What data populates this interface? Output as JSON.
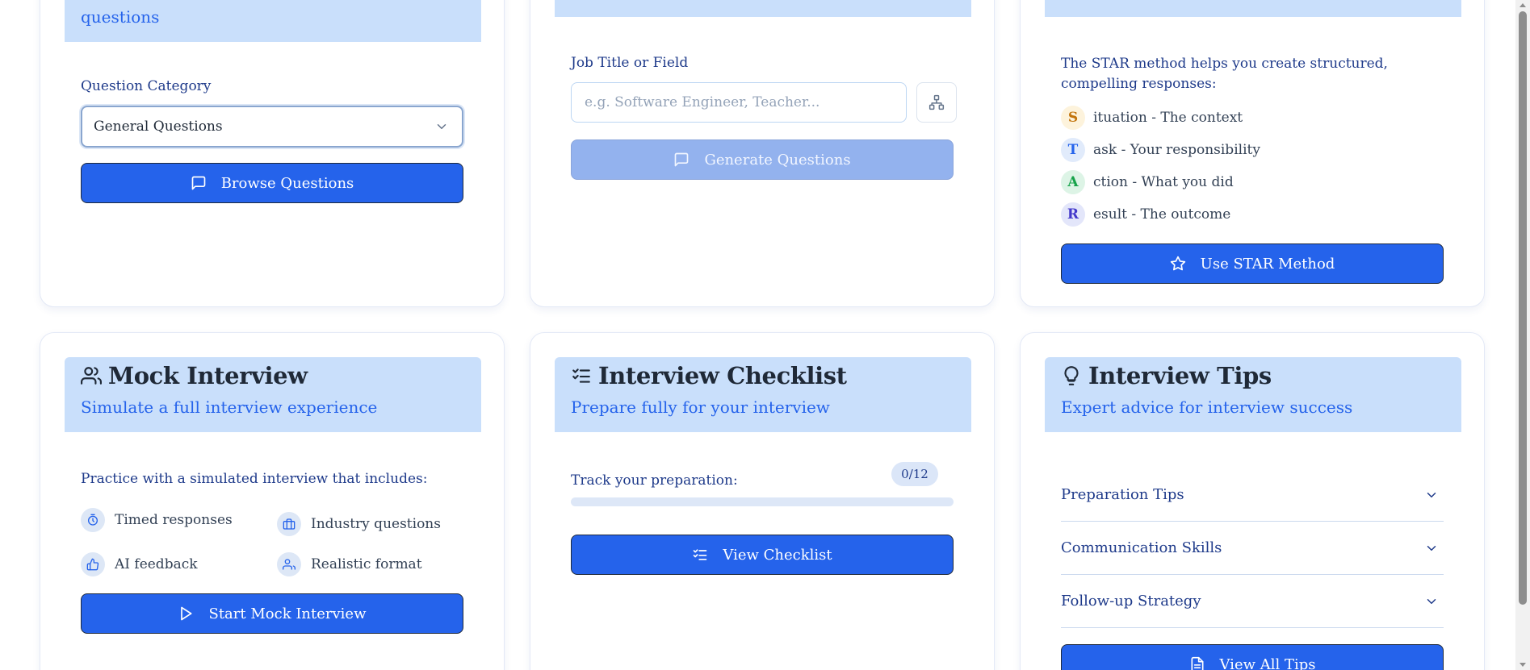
{
  "card_practice": {
    "subtitle_tail": "questions",
    "category_label": "Question Category",
    "category_value": "General Questions",
    "browse_button": "Browse Questions"
  },
  "card_custom": {
    "job_label": "Job Title or Field",
    "job_placeholder": "e.g. Software Engineer, Teacher...",
    "generate_button": "Generate Questions"
  },
  "card_star": {
    "intro": "The STAR method helps you create structured, compelling responses:",
    "steps": [
      {
        "letter": "S",
        "text": "ituation - The context"
      },
      {
        "letter": "T",
        "text": "ask - Your responsibility"
      },
      {
        "letter": "A",
        "text": "ction - What you did"
      },
      {
        "letter": "R",
        "text": "esult - The outcome"
      }
    ],
    "button": "Use STAR Method"
  },
  "card_mock": {
    "title": "Mock Interview",
    "subtitle": "Simulate a full interview experience",
    "intro": "Practice with a simulated interview that includes:",
    "features": [
      "Timed responses",
      "Industry questions",
      "AI feedback",
      "Realistic format"
    ],
    "button": "Start Mock Interview"
  },
  "card_checklist": {
    "title": "Interview Checklist",
    "subtitle": "Prepare fully for your interview",
    "track_label": "Track your preparation:",
    "count": "0/12",
    "progress_percent": 0,
    "button": "View Checklist"
  },
  "card_tips": {
    "title": "Interview Tips",
    "subtitle": "Expert advice for interview success",
    "items": [
      "Preparation Tips",
      "Communication Skills",
      "Follow-up Strategy"
    ],
    "button": "View All Tips"
  },
  "colors": {
    "accent": "#2563eb",
    "header_band": "#c9dffb",
    "text_dark_blue": "#1e3a8a",
    "star_s": "#c2740c",
    "star_t": "#2563eb",
    "star_a": "#16a34a",
    "star_r": "#4338ca"
  }
}
